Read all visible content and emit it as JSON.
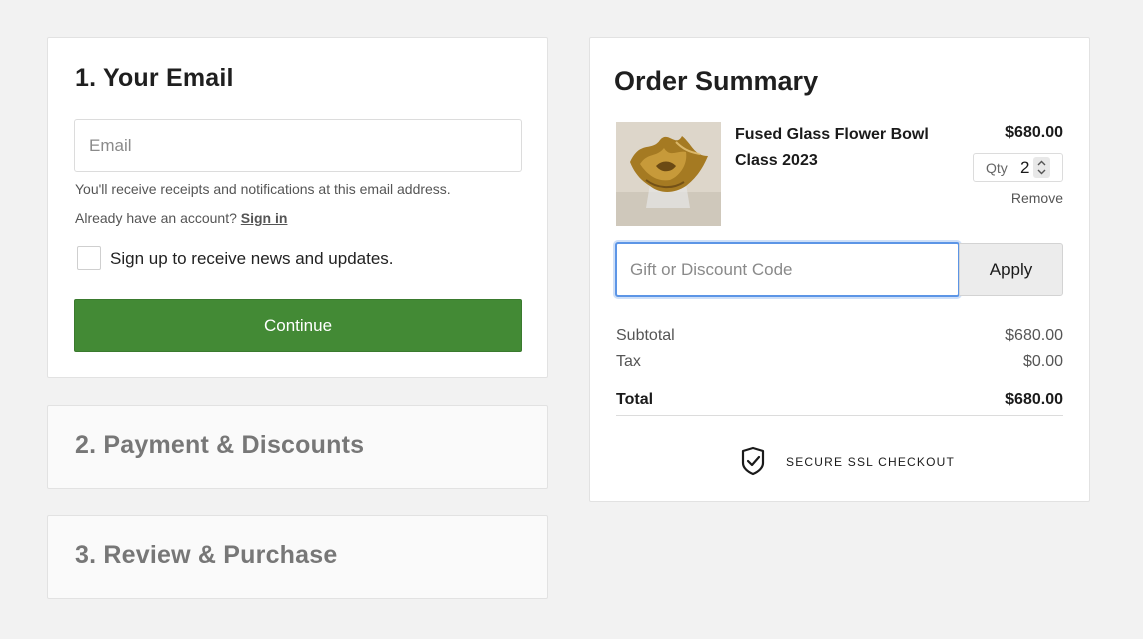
{
  "email_section": {
    "title": "1.  Your Email",
    "email_placeholder": "Email",
    "email_value": "",
    "hint": "You'll receive receipts and notifications at this email address.",
    "account_prompt": "Already have an account?",
    "sign_in_label": "Sign in",
    "newsletter_label": "Sign up to receive news and updates.",
    "newsletter_checked": false,
    "continue_label": "Continue",
    "continue_color": "#438a35"
  },
  "payment_section": {
    "title": "2.  Payment & Discounts"
  },
  "review_section": {
    "title": "3.  Review & Purchase"
  },
  "order_summary": {
    "title": "Order Summary",
    "item": {
      "name": "Fused Glass Flower Bowl Class 2023",
      "price": "$680.00",
      "qty_label": "Qty",
      "qty_value": "2",
      "remove_label": "Remove",
      "image_icon": "glass-flower-bowl-image"
    },
    "discount": {
      "placeholder": "Gift or Discount Code",
      "value": "",
      "apply_label": "Apply",
      "focus_color": "#5c95e6"
    },
    "subtotal_label": "Subtotal",
    "subtotal_value": "$680.00",
    "tax_label": "Tax",
    "tax_value": "$0.00",
    "total_label": "Total",
    "total_value": "$680.00",
    "secure_icon": "shield-check-icon",
    "secure_label": "SECURE SSL CHECKOUT"
  }
}
